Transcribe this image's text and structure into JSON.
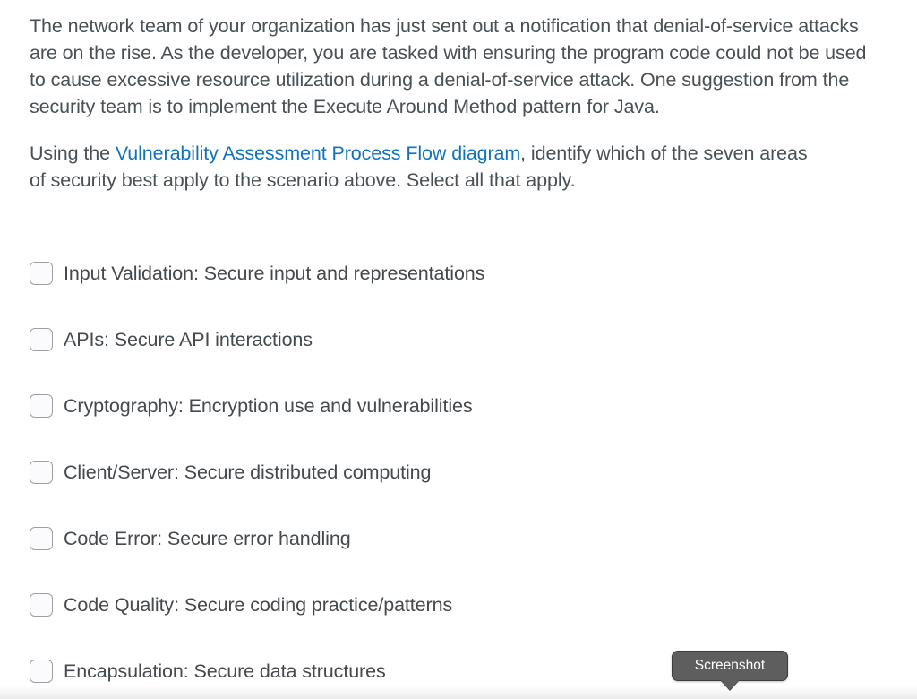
{
  "question": {
    "paragraph_1": "The network team of your organization has just sent out a notification that denial-of-service attacks are on the rise. As the developer, you are tasked with ensuring the program code could not be used to cause excessive resource utilization during a denial-of-service attack. One suggestion from the security team is to implement the Execute Around Method pattern for Java.",
    "paragraph_2_prefix": "Using the ",
    "link_text": "Vulnerability Assessment Process Flow diagram",
    "paragraph_2_suffix": ", identify which of the seven areas of security best apply to the scenario above. Select all that apply."
  },
  "answers": [
    {
      "label": "Input Validation: Secure input and representations",
      "checked": false
    },
    {
      "label": "APIs: Secure API interactions",
      "checked": false
    },
    {
      "label": "Cryptography: Encryption use and vulnerabilities",
      "checked": false
    },
    {
      "label": "Client/Server: Secure distributed computing",
      "checked": false
    },
    {
      "label": "Code Error: Secure error handling",
      "checked": false
    },
    {
      "label": "Code Quality: Secure coding practice/patterns",
      "checked": false
    },
    {
      "label": "Encapsulation: Secure data structures",
      "checked": false
    }
  ],
  "tooltip": {
    "label": "Screenshot"
  },
  "colors": {
    "body_text": "#4a5156",
    "link": "#1273bd",
    "checkbox_border": "#9aa0a6",
    "checkbox_fill": "#fbfbfd",
    "tooltip_bg": "#5e5e5e",
    "tooltip_text": "#ffffff",
    "page_bg": "#ffffff"
  }
}
